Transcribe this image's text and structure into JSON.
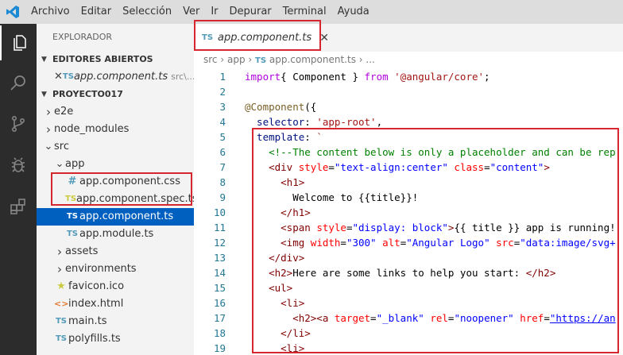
{
  "menu": [
    "Archivo",
    "Editar",
    "Selección",
    "Ver",
    "Ir",
    "Depurar",
    "Terminal",
    "Ayuda"
  ],
  "activity_icons": [
    "explorer-icon",
    "search-icon",
    "source-control-icon",
    "debug-icon",
    "extensions-icon"
  ],
  "sidebar": {
    "title": "EXPLORADOR",
    "open_editors": {
      "header": "EDITORES ABIERTOS",
      "item_name": "app.component.ts",
      "item_path": "src\\..."
    },
    "project": {
      "header": "PROYECTO017",
      "items": [
        {
          "name": "e2e",
          "kind": "folder",
          "indent": 0
        },
        {
          "name": "node_modules",
          "kind": "folder",
          "indent": 0
        },
        {
          "name": "src",
          "kind": "folder-open",
          "indent": 0
        },
        {
          "name": "app",
          "kind": "folder-open",
          "indent": 1
        },
        {
          "name": "app.component.css",
          "kind": "css",
          "indent": 2
        },
        {
          "name": "app.component.spec.ts",
          "kind": "spec",
          "indent": 2
        },
        {
          "name": "app.component.ts",
          "kind": "ts",
          "indent": 2,
          "selected": true
        },
        {
          "name": "app.module.ts",
          "kind": "ts",
          "indent": 2
        },
        {
          "name": "assets",
          "kind": "folder",
          "indent": 1
        },
        {
          "name": "environments",
          "kind": "folder",
          "indent": 1
        },
        {
          "name": "favicon.ico",
          "kind": "star",
          "indent": 1
        },
        {
          "name": "index.html",
          "kind": "html",
          "indent": 1
        },
        {
          "name": "main.ts",
          "kind": "ts",
          "indent": 1
        },
        {
          "name": "polyfills.ts",
          "kind": "ts",
          "indent": 1
        }
      ]
    }
  },
  "editor": {
    "tab_label": "app.component.ts",
    "tab_badge": "TS",
    "breadcrumb": {
      "p1": "src",
      "p2": "app",
      "p3": "app.component.ts",
      "p4": "..."
    },
    "lines": [
      [
        [
          "kw2",
          "import"
        ],
        [
          "",
          "{ Component } "
        ],
        [
          "kw2",
          "from"
        ],
        [
          "str",
          " '@angular/core'"
        ],
        [
          "",
          ";"
        ]
      ],
      [],
      [
        [
          "dec",
          "@Component"
        ],
        [
          "",
          "({"
        ]
      ],
      [
        [
          "prop",
          "  selector"
        ],
        [
          "",
          ": "
        ],
        [
          "str",
          "'app-root'"
        ],
        [
          "",
          ","
        ]
      ],
      [
        [
          "prop",
          "  template"
        ],
        [
          "",
          ": "
        ],
        [
          "str",
          "`"
        ]
      ],
      [
        [
          "cmt",
          "    <!--The content below is only a placeholder and can be rep"
        ]
      ],
      [
        [
          "tag",
          "    <div"
        ],
        [
          "attr",
          " style"
        ],
        [
          "",
          "="
        ],
        [
          "aval",
          "\"text-align:center\""
        ],
        [
          "attr",
          " class"
        ],
        [
          "",
          "="
        ],
        [
          "aval",
          "\"content\""
        ],
        [
          "tag",
          ">"
        ]
      ],
      [
        [
          "tag",
          "      <h1>"
        ]
      ],
      [
        [
          "",
          "        Welcome to {{title}}!"
        ]
      ],
      [
        [
          "tag",
          "      </h1>"
        ]
      ],
      [
        [
          "tag",
          "      <span"
        ],
        [
          "attr",
          " style"
        ],
        [
          "",
          "="
        ],
        [
          "aval",
          "\"display: block\""
        ],
        [
          "tag",
          ">"
        ],
        [
          "",
          "{{ title }} app is running!"
        ]
      ],
      [
        [
          "tag",
          "      <img"
        ],
        [
          "attr",
          " width"
        ],
        [
          "",
          "="
        ],
        [
          "aval",
          "\"300\""
        ],
        [
          "attr",
          " alt"
        ],
        [
          "",
          "="
        ],
        [
          "aval",
          "\"Angular Logo\""
        ],
        [
          "attr",
          " src"
        ],
        [
          "",
          "="
        ],
        [
          "aval",
          "\"data:image/svg+"
        ]
      ],
      [
        [
          "tag",
          "    </div>"
        ]
      ],
      [
        [
          "tag",
          "    <h2>"
        ],
        [
          "",
          "Here are some links to help you start: "
        ],
        [
          "tag",
          "</h2>"
        ]
      ],
      [
        [
          "tag",
          "    <ul>"
        ]
      ],
      [
        [
          "tag",
          "      <li>"
        ]
      ],
      [
        [
          "tag",
          "        <h2><a"
        ],
        [
          "attr",
          " target"
        ],
        [
          "",
          "="
        ],
        [
          "aval",
          "\"_blank\""
        ],
        [
          "attr",
          " rel"
        ],
        [
          "",
          "="
        ],
        [
          "aval",
          "\"noopener\""
        ],
        [
          "attr",
          " href"
        ],
        [
          "",
          "="
        ],
        [
          "aval",
          "\"https://an"
        ]
      ],
      [
        [
          "tag",
          "      </li>"
        ]
      ],
      [
        [
          "tag",
          "      <li>"
        ]
      ]
    ]
  }
}
